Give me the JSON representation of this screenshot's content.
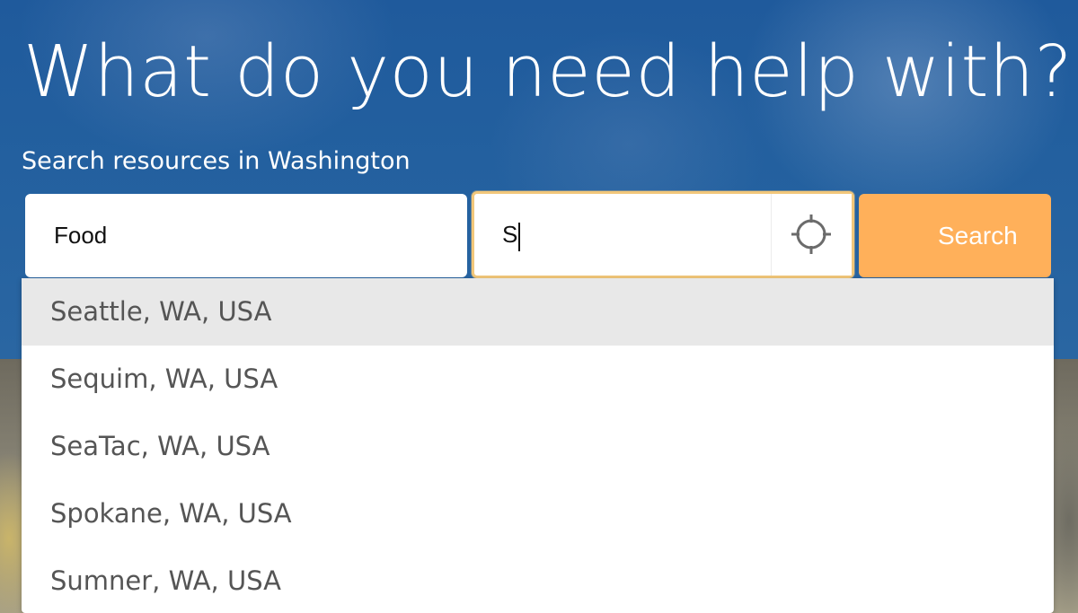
{
  "hero": {
    "headline": "What do you need help with?",
    "subheadline": "Search resources in Washington"
  },
  "search": {
    "need_value": "Food",
    "location_value": "S",
    "locate_icon": "crosshair-icon",
    "button_icon": "search-icon",
    "button_label": "Search"
  },
  "suggestions": [
    {
      "label": "Seattle, WA, USA",
      "highlighted": true
    },
    {
      "label": "Sequim, WA, USA",
      "highlighted": false
    },
    {
      "label": "SeaTac, WA, USA",
      "highlighted": false
    },
    {
      "label": "Spokane, WA, USA",
      "highlighted": false
    },
    {
      "label": "Sumner, WA, USA",
      "highlighted": false
    }
  ],
  "colors": {
    "hero_blue": "#23609f",
    "search_button": "#ffb05a",
    "location_focus_border": "#f2c77a",
    "suggestion_highlight": "#e8e8e8"
  }
}
